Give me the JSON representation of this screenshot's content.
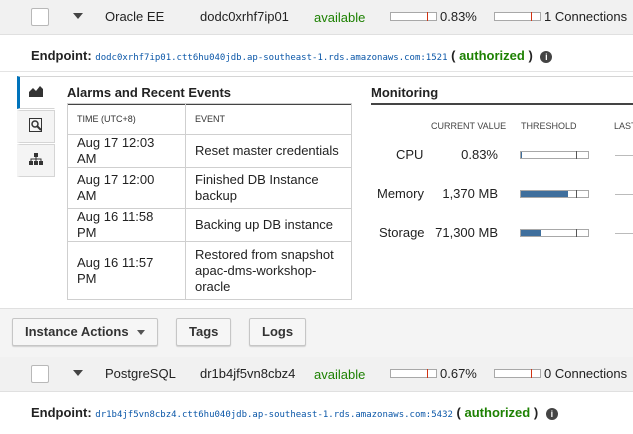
{
  "instances": [
    {
      "engine": "Oracle EE",
      "db_id": "dodc0xrhf7ip01",
      "status": "available",
      "cpu_pct": "0.83%",
      "connections": "1 Connections",
      "endpoint_label": "Endpoint:",
      "endpoint_address": "dodc0xrhf7ip01.ctt6hu040jdb.ap-southeast-1.rds.amazonaws.com:1521",
      "endpoint_status": "authorized"
    },
    {
      "engine": "PostgreSQL",
      "db_id": "dr1b4jf5vn8cbz4",
      "status": "available",
      "cpu_pct": "0.67%",
      "connections": "0 Connections",
      "endpoint_label": "Endpoint:",
      "endpoint_address": "dr1b4jf5vn8cbz4.ctt6hu040jdb.ap-southeast-1.rds.amazonaws.com:5432",
      "endpoint_status": "authorized"
    }
  ],
  "side_tabs": [
    {
      "icon": "area-chart-icon",
      "active": true
    },
    {
      "icon": "search-document-icon",
      "active": false
    },
    {
      "icon": "hierarchy-icon",
      "active": false
    }
  ],
  "alarms": {
    "title": "Alarms and Recent Events",
    "col_time": "TIME (UTC+8)",
    "col_event": "EVENT",
    "rows": [
      {
        "time": "Aug 17 12:03 AM",
        "event": "Reset master credentials"
      },
      {
        "time": "Aug 17 12:00 AM",
        "event": "Finished DB Instance backup"
      },
      {
        "time": "Aug 16 11:58 PM",
        "event": "Backing up DB instance"
      },
      {
        "time": "Aug 16 11:57 PM",
        "event": "Restored from snapshot apac-dms-workshop-oracle"
      }
    ]
  },
  "monitoring": {
    "title": "Monitoring",
    "col_current": "CURRENT VALUE",
    "col_threshold": "THRESHOLD",
    "col_last": "LAST",
    "metrics": [
      {
        "name": "CPU",
        "value": "0.83%",
        "fill_fraction": 0.01
      },
      {
        "name": "Memory",
        "value": "1,370 MB",
        "fill_fraction": 0.7
      },
      {
        "name": "Storage",
        "value": "71,300 MB",
        "fill_fraction": 0.3
      }
    ]
  },
  "actions": {
    "instance_actions": "Instance Actions",
    "tags": "Tags",
    "logs": "Logs"
  },
  "colors": {
    "available": "#1d8102",
    "link": "#0b57a8",
    "active_tab": "#0073bb",
    "metric_fill": "#3f6f9d"
  }
}
